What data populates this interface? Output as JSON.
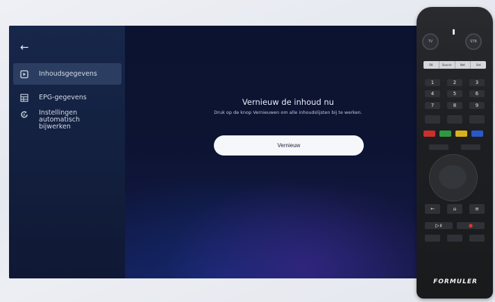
{
  "sidebar": {
    "back_glyph": "←",
    "items": [
      {
        "label": "Inhoudsgegevens",
        "icon": "content-data-icon",
        "active": true
      },
      {
        "label": "EPG-gegevens",
        "icon": "epg-grid-icon",
        "active": false
      },
      {
        "label": "Instellingen automatisch bijwerken",
        "icon": "auto-update-icon",
        "active": false
      }
    ]
  },
  "main": {
    "title": "Vernieuw de inhoud nu",
    "description": "Druk op de knop Vernieuwen om alle inhoudslijsten bij te werken.",
    "button_label": "Vernieuw"
  },
  "remote": {
    "round_left": "TV",
    "round_right": "STB",
    "strip": [
      "OK",
      "Source",
      "Net",
      "Set"
    ],
    "digits": [
      "1",
      "2",
      "3",
      "4",
      "5",
      "6",
      "7",
      "8",
      "9"
    ],
    "logo": "FORMULER"
  },
  "colors": {
    "sidebar_active": "#2b3e62",
    "button_bg": "#f6f7fa",
    "red": "#c9302c",
    "green": "#2e9a3f",
    "yellow": "#d8b21c",
    "blue": "#2b58c8"
  }
}
